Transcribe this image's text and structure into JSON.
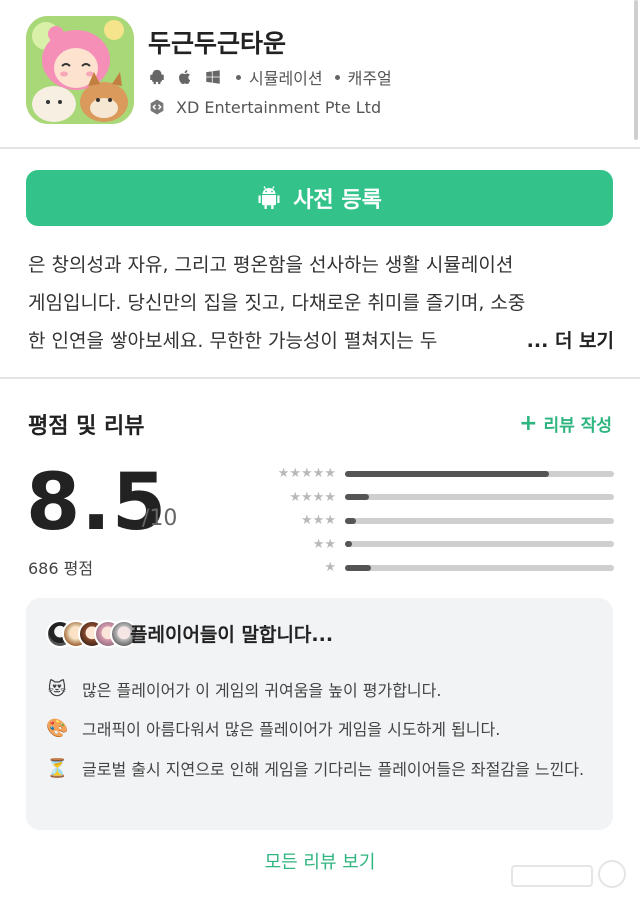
{
  "app": {
    "title": "두근두근타운",
    "platform_icons": [
      "android-icon",
      "apple-icon",
      "windows-icon"
    ],
    "genre1": "시뮬레이션",
    "genre2": "캐주얼",
    "developer_icon": "developer-badge-icon",
    "developer": "XD Entertainment Pte Ltd"
  },
  "preregister": {
    "label": "사전 등록",
    "icon": "android-icon",
    "color": "#33c38a"
  },
  "description": {
    "lines": [
      "은 창의성과 자유, 그리고 평온함을 선사하는 생활 시뮬레이션",
      "게임입니다. 당신만의 집을 짓고, 다채로운 취미를 즐기며, 소중",
      "한 인연을 쌓아보세요. 무한한 가능성이 펼쳐지는 두"
    ],
    "more_label": "... 더 보기"
  },
  "ratings": {
    "section_title": "평점 및 리뷰",
    "write_review_label": "리뷰 작성",
    "score": "8.5",
    "out_of": "/10",
    "count_label": "686 평점",
    "distribution": [
      {
        "stars": 5,
        "fraction": 0.76
      },
      {
        "stars": 4,
        "fraction": 0.09
      },
      {
        "stars": 3,
        "fraction": 0.04
      },
      {
        "stars": 2,
        "fraction": 0.025
      },
      {
        "stars": 1,
        "fraction": 0.095
      }
    ]
  },
  "players_say": {
    "title": "플레이어들이 말합니다...",
    "items": [
      {
        "emoji": "😻",
        "icon": "heart-eyes-cat-icon",
        "text": "많은 플레이어가 이 게임의 귀여움을 높이 평가합니다."
      },
      {
        "emoji": "🎨",
        "icon": "palette-icon",
        "text": "그래픽이 아름다워서 많은 플레이어가 게임을 시도하게 됩니다."
      },
      {
        "emoji": "⏳",
        "icon": "hourglass-icon",
        "text": "글로벌 출시 지연으로 인해 게임을 기다리는 플레이어들은 좌절감을 느낀다."
      }
    ]
  },
  "all_reviews_label": "모든 리뷰 보기",
  "colors": {
    "accent": "#2fb57f",
    "button": "#33c38a",
    "card_bg": "#f2f3f5"
  }
}
